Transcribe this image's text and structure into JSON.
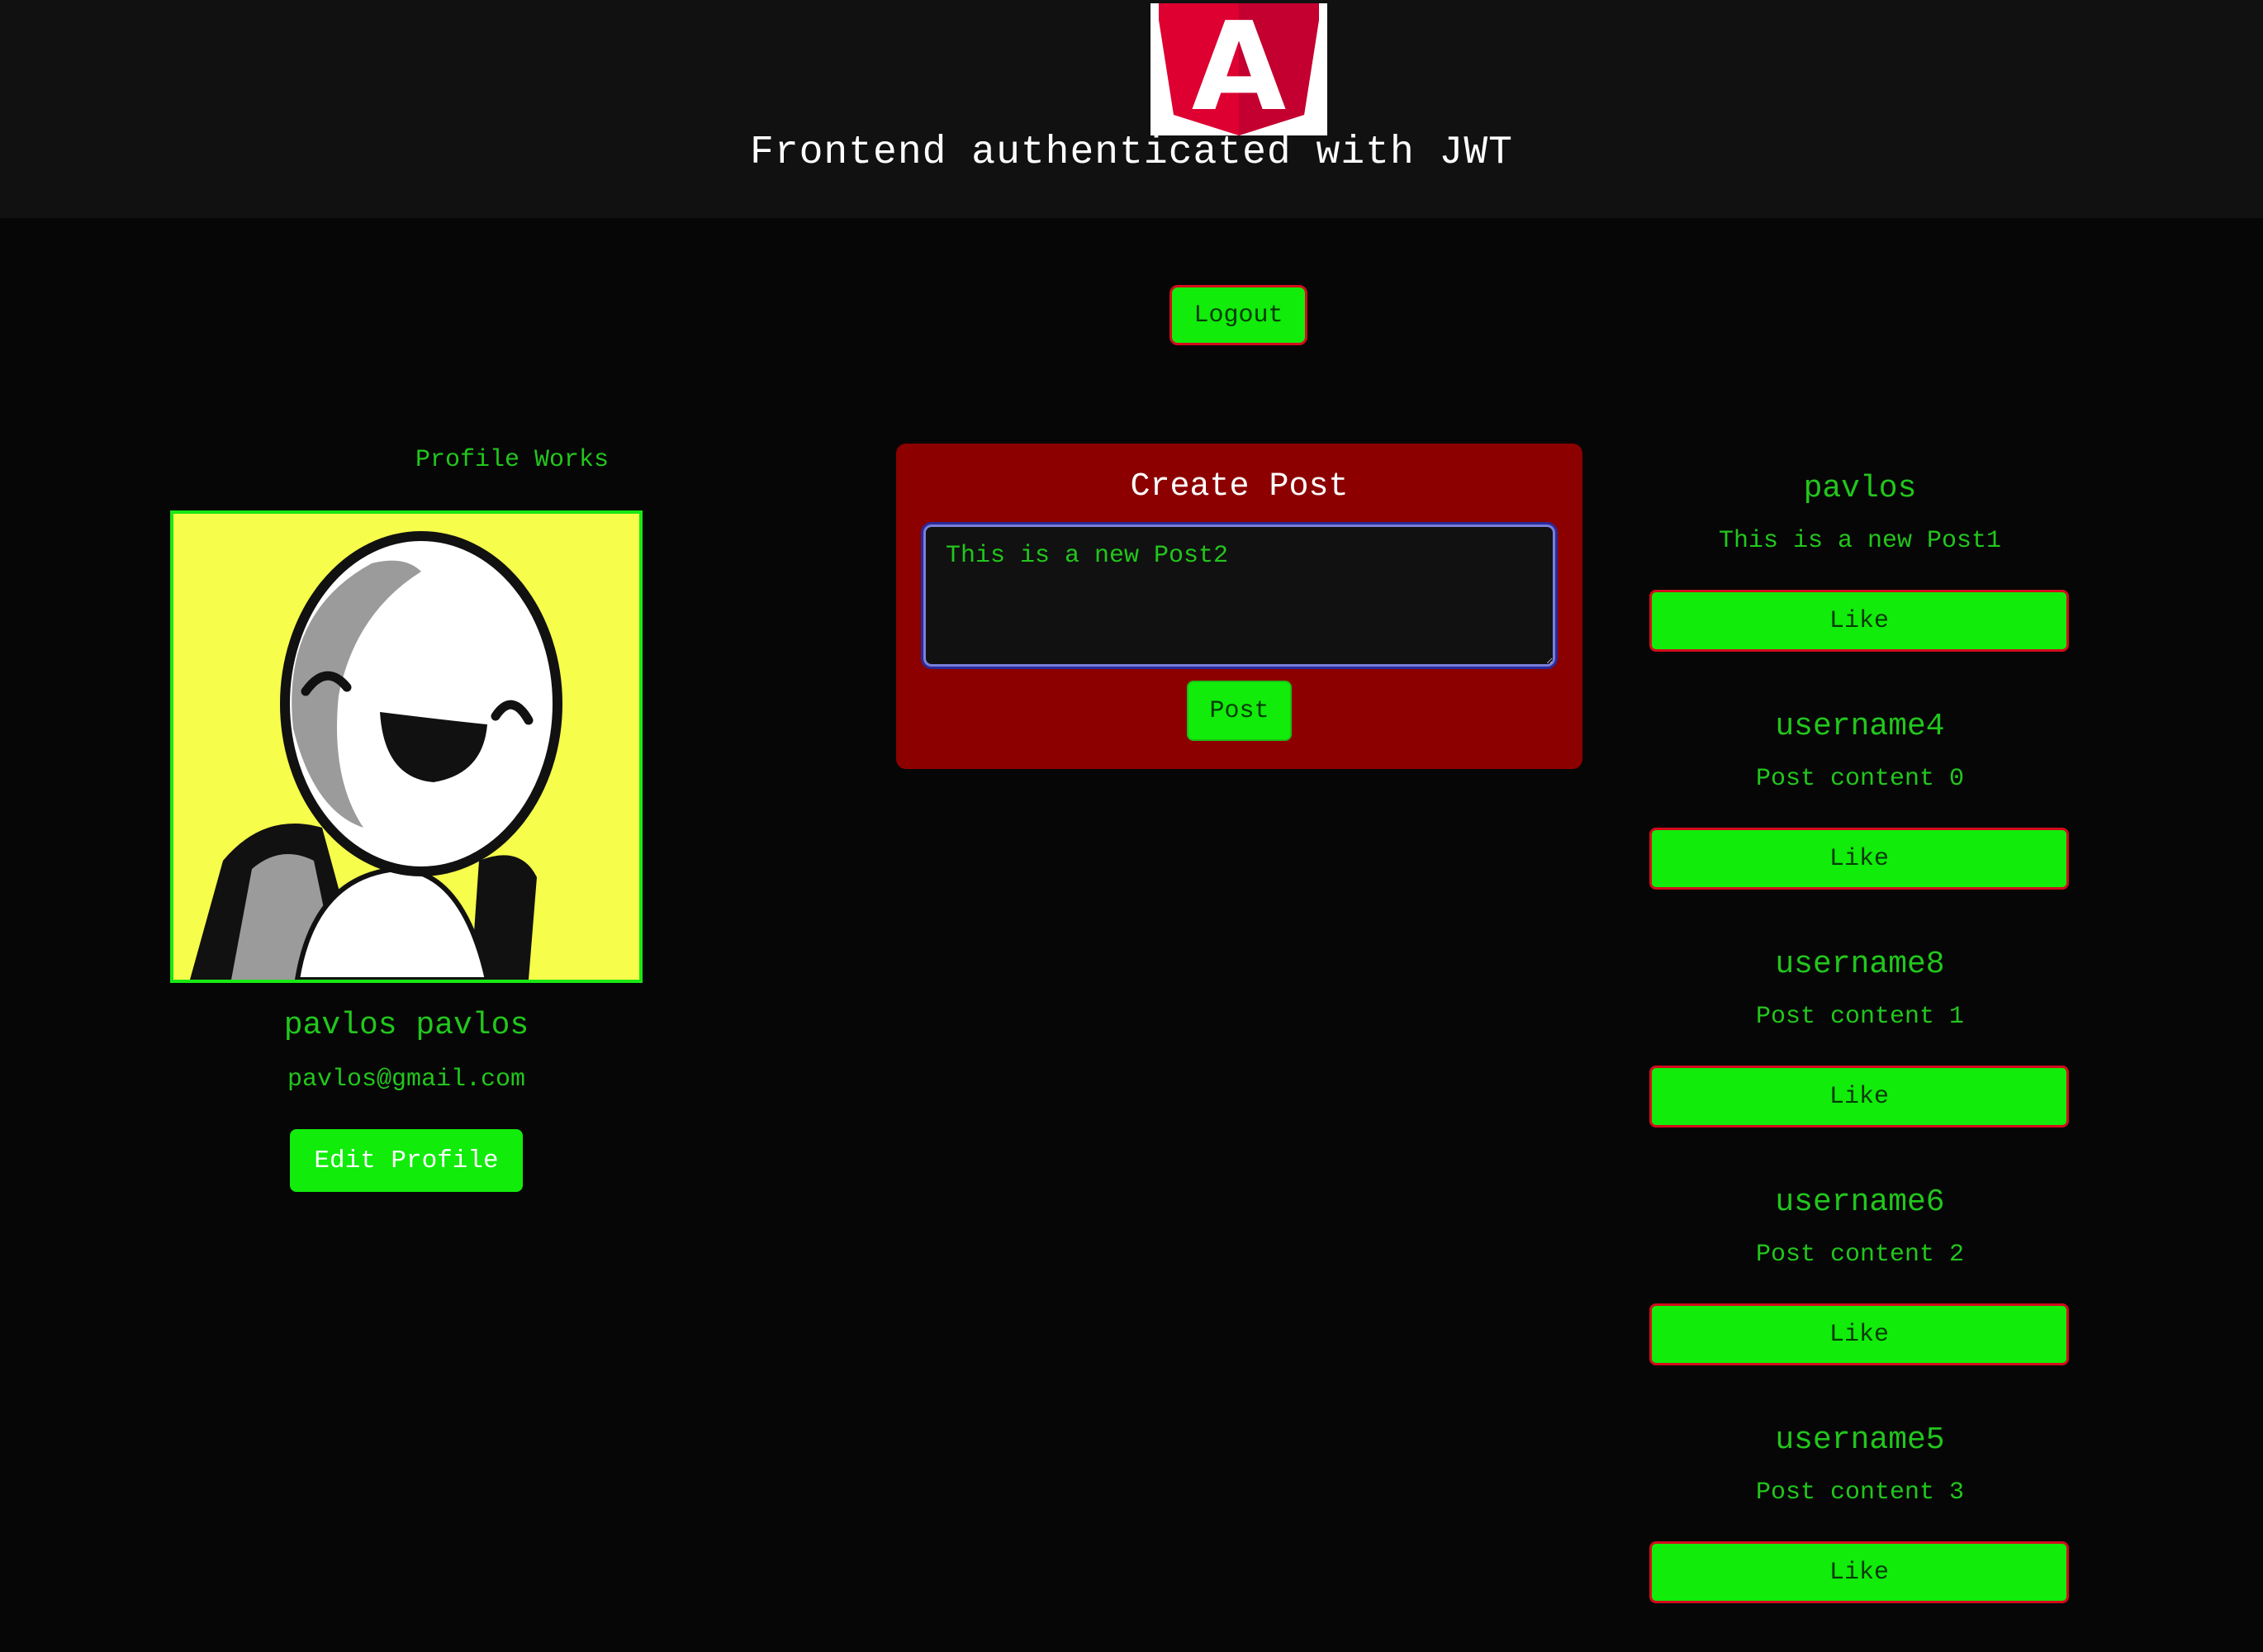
{
  "header": {
    "title": "Frontend authenticated with JWT",
    "logo_icon": "angular-logo-icon",
    "logo_letter": "A"
  },
  "nav": {
    "logout_label": "Logout"
  },
  "profile": {
    "heading": "Profile Works",
    "avatar_icon": "avatar-icon",
    "name": "pavlos pavlos",
    "email": "pavlos@gmail.com",
    "edit_label": "Edit Profile"
  },
  "create_post": {
    "title": "Create Post",
    "textarea_value": "This is a new Post2",
    "post_label": "Post"
  },
  "feed": {
    "like_label": "Like",
    "posts": [
      {
        "username": "pavlos",
        "content": "This is a new Post1"
      },
      {
        "username": "username4",
        "content": "Post content 0"
      },
      {
        "username": "username8",
        "content": "Post content 1"
      },
      {
        "username": "username6",
        "content": "Post content 2"
      },
      {
        "username": "username5",
        "content": "Post content 3"
      }
    ]
  },
  "colors": {
    "accent_green": "#11ec0b",
    "text_green": "#22c61c",
    "card_red": "#8c0000",
    "border_red": "#d40b1c",
    "background": "#060606",
    "header_bg": "#111111"
  }
}
